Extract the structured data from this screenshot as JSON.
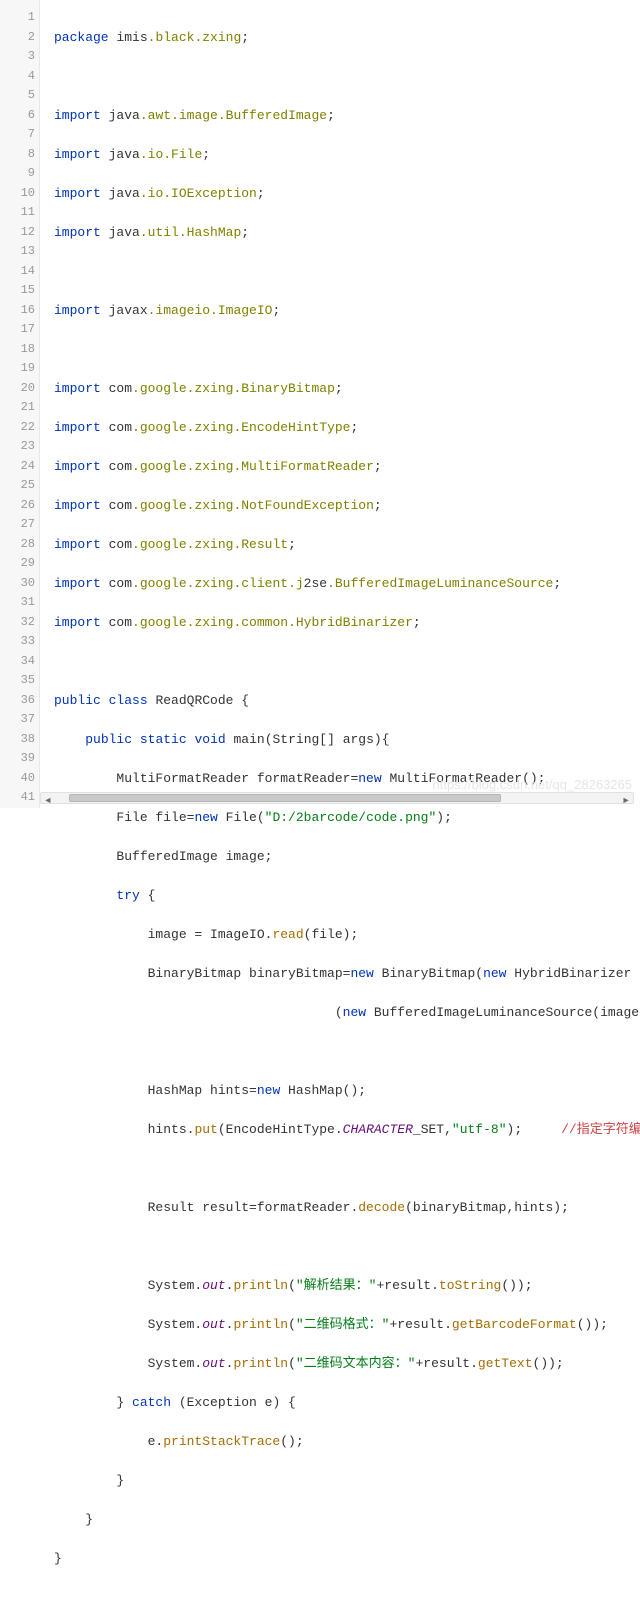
{
  "editor": {
    "lines": 41,
    "gutter": [
      "1",
      "2",
      "3",
      "4",
      "5",
      "6",
      "7",
      "8",
      "9",
      "10",
      "11",
      "12",
      "13",
      "14",
      "15",
      "16",
      "17",
      "18",
      "19",
      "20",
      "21",
      "22",
      "23",
      "24",
      "25",
      "26",
      "27",
      "28",
      "29",
      "30",
      "31",
      "32",
      "33",
      "34",
      "35",
      "36",
      "37",
      "38",
      "39",
      "40",
      "41"
    ]
  },
  "tokens": {
    "kw_package": "package",
    "kw_import": "import",
    "kw_public": "public",
    "kw_class": "class",
    "kw_static": "static",
    "kw_void": "void",
    "kw_new": "new",
    "kw_try": "try",
    "kw_catch": "catch"
  },
  "code": {
    "l1_a": "package ",
    "l1_b": "imis",
    "l1_c": ".black.zxing",
    "l1_d": ";",
    "l3_a": "import ",
    "l3_b": "java",
    "l3_c": ".awt.image.BufferedImage",
    "l3_d": ";",
    "l4_a": "import ",
    "l4_b": "java",
    "l4_c": ".io.File",
    "l4_d": ";",
    "l5_a": "import ",
    "l5_b": "java",
    "l5_c": ".io.IOException",
    "l5_d": ";",
    "l6_a": "import ",
    "l6_b": "java",
    "l6_c": ".util.HashMap",
    "l6_d": ";",
    "l8_a": "import ",
    "l8_b": "javax",
    "l8_c": ".imageio.ImageIO",
    "l8_d": ";",
    "l10_a": "import ",
    "l10_b": "com",
    "l10_c": ".google.zxing.BinaryBitmap",
    "l10_d": ";",
    "l11_a": "import ",
    "l11_b": "com",
    "l11_c": ".google.zxing.EncodeHintType",
    "l11_d": ";",
    "l12_a": "import ",
    "l12_b": "com",
    "l12_c": ".google.zxing.MultiFormatReader",
    "l12_d": ";",
    "l13_a": "import ",
    "l13_b": "com",
    "l13_c": ".google.zxing.NotFoundException",
    "l13_d": ";",
    "l14_a": "import ",
    "l14_b": "com",
    "l14_c": ".google.zxing.Result",
    "l14_d": ";",
    "l15_a": "import ",
    "l15_b": "com",
    "l15_c": ".google.zxing.client.j",
    "l15_d": "2se",
    "l15_e": ".BufferedImageLuminanceSource",
    "l15_f": ";",
    "l16_a": "import ",
    "l16_b": "com",
    "l16_c": ".google.zxing.common.HybridBinarizer",
    "l16_d": ";",
    "l18": "public class ReadQRCode {",
    "l19": "    public static void main(String[] args){",
    "l20": "        MultiFormatReader formatReader=new MultiFormatReader();",
    "l21_a": "        File file=new File(",
    "l21_b": "\"D:/2barcode/code.png\"",
    "l21_c": ");",
    "l22": "        BufferedImage image;",
    "l23": "        try {",
    "l24_a": "            image = ImageIO.",
    "l24_b": "read",
    "l24_c": "(file);",
    "l25": "            BinaryBitmap binaryBitmap=new BinaryBitmap(new HybridBinarizer",
    "l26": "                                    (new BufferedImageLuminanceSource(image)));",
    "l28": "            HashMap hints=new HashMap();",
    "l29_a": "            hints.",
    "l29_b": "put",
    "l29_c": "(EncodeHintType.",
    "l29_d": "CHARACTER",
    "l29_e": "_SET,",
    "l29_f": "\"utf-8\"",
    "l29_g": ");     ",
    "l29_h": "//指定字符编码为\"utf-",
    "l31_a": "            Result result=formatReader.",
    "l31_b": "decode",
    "l31_c": "(binaryBitmap,hints);",
    "l33_a": "            System.",
    "l33_b": "out",
    "l33_c": ".",
    "l33_d": "println",
    "l33_e": "(",
    "l33_f": "\"解析结果：\"",
    "l33_g": "+result.",
    "l33_h": "toString",
    "l33_i": "());",
    "l34_a": "            System.",
    "l34_b": "out",
    "l34_c": ".",
    "l34_d": "println",
    "l34_e": "(",
    "l34_f": "\"二维码格式：\"",
    "l34_g": "+result.",
    "l34_h": "getBarcodeFormat",
    "l34_i": "());",
    "l35_a": "            System.",
    "l35_b": "out",
    "l35_c": ".",
    "l35_d": "println",
    "l35_e": "(",
    "l35_f": "\"二维码文本内容：\"",
    "l35_g": "+result.",
    "l35_h": "getText",
    "l35_i": "());",
    "l36": "        } catch (Exception e) {",
    "l37_a": "            e.",
    "l37_b": "printStackTrace",
    "l37_c": "();",
    "l38": "        }",
    "l39": "    }",
    "l40": "}"
  },
  "watermark": "https://blog.csdn.net/qq_28263265",
  "scroll": {
    "left_arrow": "◄",
    "right_arrow": "►"
  },
  "chart_data": null
}
